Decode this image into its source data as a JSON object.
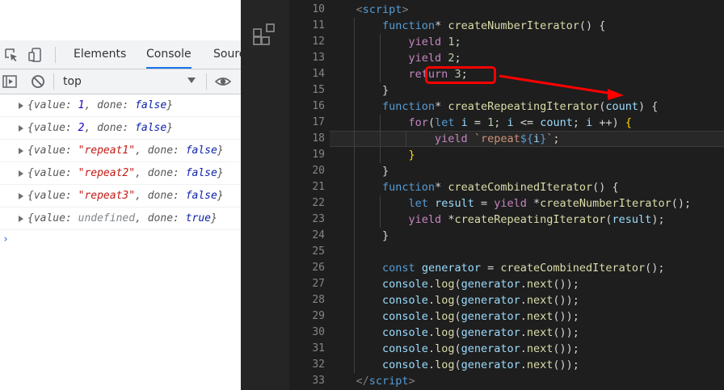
{
  "devtools": {
    "tabs": [
      {
        "label": "Elements",
        "active": false
      },
      {
        "label": "Console",
        "active": true
      },
      {
        "label": "Sourc",
        "active": false
      }
    ],
    "toolbar": {
      "context": "top"
    },
    "console_rows": [
      [
        {
          "t": "{value: ",
          "c": "k"
        },
        {
          "t": "1",
          "c": "n"
        },
        {
          "t": ", done: ",
          "c": "k"
        },
        {
          "t": "false",
          "c": "b"
        },
        {
          "t": "}",
          "c": "k"
        }
      ],
      [
        {
          "t": "{value: ",
          "c": "k"
        },
        {
          "t": "2",
          "c": "n"
        },
        {
          "t": ", done: ",
          "c": "k"
        },
        {
          "t": "false",
          "c": "b"
        },
        {
          "t": "}",
          "c": "k"
        }
      ],
      [
        {
          "t": "{value: ",
          "c": "k"
        },
        {
          "t": "\"repeat1\"",
          "c": "s"
        },
        {
          "t": ", done: ",
          "c": "k"
        },
        {
          "t": "false",
          "c": "b"
        },
        {
          "t": "}",
          "c": "k"
        }
      ],
      [
        {
          "t": "{value: ",
          "c": "k"
        },
        {
          "t": "\"repeat2\"",
          "c": "s"
        },
        {
          "t": ", done: ",
          "c": "k"
        },
        {
          "t": "false",
          "c": "b"
        },
        {
          "t": "}",
          "c": "k"
        }
      ],
      [
        {
          "t": "{value: ",
          "c": "k"
        },
        {
          "t": "\"repeat3\"",
          "c": "s"
        },
        {
          "t": ", done: ",
          "c": "k"
        },
        {
          "t": "false",
          "c": "b"
        },
        {
          "t": "}",
          "c": "k"
        }
      ],
      [
        {
          "t": "{value: ",
          "c": "k"
        },
        {
          "t": "undefined",
          "c": "u"
        },
        {
          "t": ", done: ",
          "c": "k"
        },
        {
          "t": "true",
          "c": "b"
        },
        {
          "t": "}",
          "c": "k"
        }
      ]
    ],
    "prompt": "›"
  },
  "editor": {
    "lines": [
      {
        "n": "10",
        "seg": [
          {
            "t": "    ",
            "c": ""
          },
          {
            "t": "<",
            "c": "ang"
          },
          {
            "t": "script",
            "c": "tag"
          },
          {
            "t": ">",
            "c": "ang"
          }
        ]
      },
      {
        "n": "11",
        "seg": [
          {
            "t": "        ",
            "c": ""
          },
          {
            "t": "function",
            "c": "kw"
          },
          {
            "t": "* ",
            "c": ""
          },
          {
            "t": "createNumberIterator",
            "c": "fn"
          },
          {
            "t": "() {",
            "c": ""
          }
        ]
      },
      {
        "n": "12",
        "seg": [
          {
            "t": "            ",
            "c": ""
          },
          {
            "t": "yield",
            "c": "kwc"
          },
          {
            "t": " ",
            "c": ""
          },
          {
            "t": "1",
            "c": "num"
          },
          {
            "t": ";",
            "c": ""
          }
        ]
      },
      {
        "n": "13",
        "seg": [
          {
            "t": "            ",
            "c": ""
          },
          {
            "t": "yield",
            "c": "kwc"
          },
          {
            "t": " ",
            "c": ""
          },
          {
            "t": "2",
            "c": "num"
          },
          {
            "t": ";",
            "c": ""
          }
        ]
      },
      {
        "n": "14",
        "seg": [
          {
            "t": "            ",
            "c": ""
          },
          {
            "t": "return",
            "c": "kwc"
          },
          {
            "t": " ",
            "c": ""
          },
          {
            "t": "3",
            "c": "num"
          },
          {
            "t": ";",
            "c": ""
          }
        ]
      },
      {
        "n": "15",
        "seg": [
          {
            "t": "        }",
            "c": ""
          }
        ]
      },
      {
        "n": "16",
        "seg": [
          {
            "t": "        ",
            "c": ""
          },
          {
            "t": "function",
            "c": "kw"
          },
          {
            "t": "* ",
            "c": ""
          },
          {
            "t": "createRepeatingIterator",
            "c": "fn"
          },
          {
            "t": "(",
            "c": ""
          },
          {
            "t": "count",
            "c": "var"
          },
          {
            "t": ") {",
            "c": ""
          }
        ]
      },
      {
        "n": "17",
        "seg": [
          {
            "t": "            ",
            "c": ""
          },
          {
            "t": "for",
            "c": "kwc"
          },
          {
            "t": "(",
            "c": ""
          },
          {
            "t": "let",
            "c": "kw"
          },
          {
            "t": " ",
            "c": ""
          },
          {
            "t": "i",
            "c": "var"
          },
          {
            "t": " = ",
            "c": ""
          },
          {
            "t": "1",
            "c": "num"
          },
          {
            "t": "; ",
            "c": ""
          },
          {
            "t": "i",
            "c": "var"
          },
          {
            "t": " <= ",
            "c": ""
          },
          {
            "t": "count",
            "c": "var"
          },
          {
            "t": "; ",
            "c": ""
          },
          {
            "t": "i",
            "c": "var"
          },
          {
            "t": " ++) ",
            "c": ""
          },
          {
            "t": "{",
            "c": "brk"
          }
        ]
      },
      {
        "n": "18",
        "cur": true,
        "seg": [
          {
            "t": "                ",
            "c": ""
          },
          {
            "t": "yield",
            "c": "kwc"
          },
          {
            "t": " ",
            "c": ""
          },
          {
            "t": "`repeat",
            "c": "str"
          },
          {
            "t": "${",
            "c": "kw"
          },
          {
            "t": "i",
            "c": "var"
          },
          {
            "t": "}",
            "c": "kw"
          },
          {
            "t": "`",
            "c": "str"
          },
          {
            "t": ";",
            "c": ""
          }
        ]
      },
      {
        "n": "19",
        "seg": [
          {
            "t": "            ",
            "c": ""
          },
          {
            "t": "}",
            "c": "brk"
          }
        ]
      },
      {
        "n": "20",
        "seg": [
          {
            "t": "        }",
            "c": ""
          }
        ]
      },
      {
        "n": "21",
        "seg": [
          {
            "t": "        ",
            "c": ""
          },
          {
            "t": "function",
            "c": "kw"
          },
          {
            "t": "* ",
            "c": ""
          },
          {
            "t": "createCombinedIterator",
            "c": "fn"
          },
          {
            "t": "() {",
            "c": ""
          }
        ]
      },
      {
        "n": "22",
        "seg": [
          {
            "t": "            ",
            "c": ""
          },
          {
            "t": "let",
            "c": "kw"
          },
          {
            "t": " ",
            "c": ""
          },
          {
            "t": "result",
            "c": "var"
          },
          {
            "t": " = ",
            "c": ""
          },
          {
            "t": "yield",
            "c": "kwc"
          },
          {
            "t": " *",
            "c": ""
          },
          {
            "t": "createNumberIterator",
            "c": "fn"
          },
          {
            "t": "();",
            "c": ""
          }
        ]
      },
      {
        "n": "23",
        "seg": [
          {
            "t": "            ",
            "c": ""
          },
          {
            "t": "yield",
            "c": "kwc"
          },
          {
            "t": " *",
            "c": ""
          },
          {
            "t": "createRepeatingIterator",
            "c": "fn"
          },
          {
            "t": "(",
            "c": ""
          },
          {
            "t": "result",
            "c": "var"
          },
          {
            "t": ");",
            "c": ""
          }
        ]
      },
      {
        "n": "24",
        "seg": [
          {
            "t": "        }",
            "c": ""
          }
        ]
      },
      {
        "n": "25",
        "seg": [
          {
            "t": "",
            "c": ""
          }
        ]
      },
      {
        "n": "26",
        "seg": [
          {
            "t": "        ",
            "c": ""
          },
          {
            "t": "const",
            "c": "kw"
          },
          {
            "t": " ",
            "c": ""
          },
          {
            "t": "generator",
            "c": "var"
          },
          {
            "t": " = ",
            "c": ""
          },
          {
            "t": "createCombinedIterator",
            "c": "fn"
          },
          {
            "t": "();",
            "c": ""
          }
        ]
      },
      {
        "n": "27",
        "seg": [
          {
            "t": "        ",
            "c": ""
          },
          {
            "t": "console",
            "c": "var"
          },
          {
            "t": ".",
            "c": ""
          },
          {
            "t": "log",
            "c": "fn"
          },
          {
            "t": "(",
            "c": ""
          },
          {
            "t": "generator",
            "c": "var"
          },
          {
            "t": ".",
            "c": ""
          },
          {
            "t": "next",
            "c": "fn"
          },
          {
            "t": "());",
            "c": ""
          }
        ]
      },
      {
        "n": "28",
        "seg": [
          {
            "t": "        ",
            "c": ""
          },
          {
            "t": "console",
            "c": "var"
          },
          {
            "t": ".",
            "c": ""
          },
          {
            "t": "log",
            "c": "fn"
          },
          {
            "t": "(",
            "c": ""
          },
          {
            "t": "generator",
            "c": "var"
          },
          {
            "t": ".",
            "c": ""
          },
          {
            "t": "next",
            "c": "fn"
          },
          {
            "t": "());",
            "c": ""
          }
        ]
      },
      {
        "n": "29",
        "seg": [
          {
            "t": "        ",
            "c": ""
          },
          {
            "t": "console",
            "c": "var"
          },
          {
            "t": ".",
            "c": ""
          },
          {
            "t": "log",
            "c": "fn"
          },
          {
            "t": "(",
            "c": ""
          },
          {
            "t": "generator",
            "c": "var"
          },
          {
            "t": ".",
            "c": ""
          },
          {
            "t": "next",
            "c": "fn"
          },
          {
            "t": "());",
            "c": ""
          }
        ]
      },
      {
        "n": "30",
        "seg": [
          {
            "t": "        ",
            "c": ""
          },
          {
            "t": "console",
            "c": "var"
          },
          {
            "t": ".",
            "c": ""
          },
          {
            "t": "log",
            "c": "fn"
          },
          {
            "t": "(",
            "c": ""
          },
          {
            "t": "generator",
            "c": "var"
          },
          {
            "t": ".",
            "c": ""
          },
          {
            "t": "next",
            "c": "fn"
          },
          {
            "t": "());",
            "c": ""
          }
        ]
      },
      {
        "n": "31",
        "seg": [
          {
            "t": "        ",
            "c": ""
          },
          {
            "t": "console",
            "c": "var"
          },
          {
            "t": ".",
            "c": ""
          },
          {
            "t": "log",
            "c": "fn"
          },
          {
            "t": "(",
            "c": ""
          },
          {
            "t": "generator",
            "c": "var"
          },
          {
            "t": ".",
            "c": ""
          },
          {
            "t": "next",
            "c": "fn"
          },
          {
            "t": "());",
            "c": ""
          }
        ]
      },
      {
        "n": "32",
        "seg": [
          {
            "t": "        ",
            "c": ""
          },
          {
            "t": "console",
            "c": "var"
          },
          {
            "t": ".",
            "c": ""
          },
          {
            "t": "log",
            "c": "fn"
          },
          {
            "t": "(",
            "c": ""
          },
          {
            "t": "generator",
            "c": "var"
          },
          {
            "t": ".",
            "c": ""
          },
          {
            "t": "next",
            "c": "fn"
          },
          {
            "t": "());",
            "c": ""
          }
        ]
      },
      {
        "n": "33",
        "seg": [
          {
            "t": "    ",
            "c": ""
          },
          {
            "t": "</",
            "c": "ang"
          },
          {
            "t": "script",
            "c": "tag"
          },
          {
            "t": ">",
            "c": "ang"
          }
        ]
      }
    ]
  },
  "annotation": {
    "color": "#ff0000"
  }
}
